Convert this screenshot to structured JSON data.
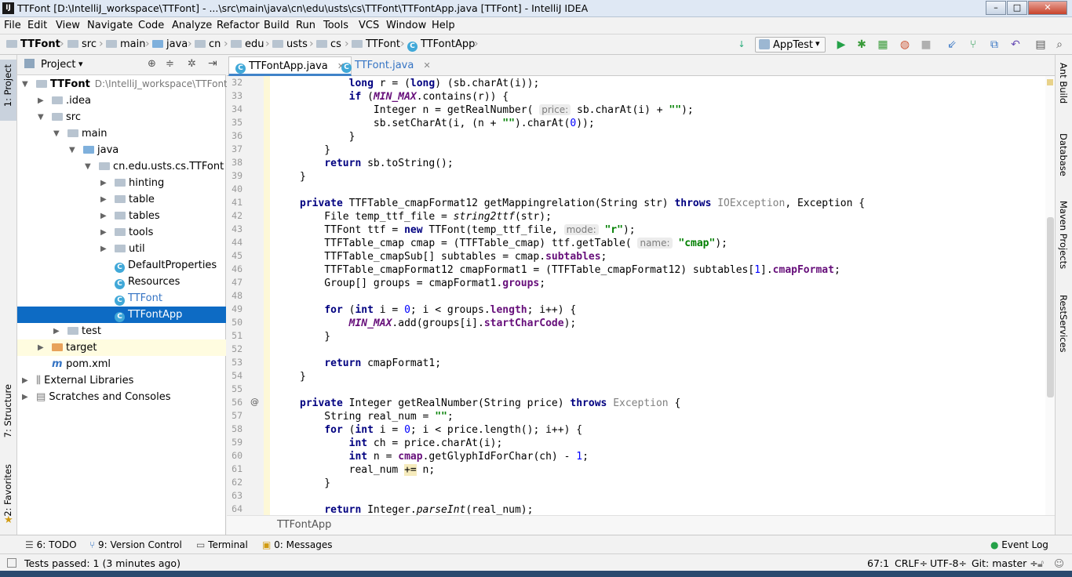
{
  "window": {
    "title": "TTFont [D:\\IntelliJ_workspace\\TTFont] - ...\\src\\main\\java\\cn\\edu\\usts\\cs\\TTFont\\TTFontApp.java [TTFont] - IntelliJ IDEA",
    "app_icon": "IJ",
    "minimize": "–",
    "maximize": "□",
    "close": "✕"
  },
  "menu": [
    "File",
    "Edit",
    "View",
    "Navigate",
    "Code",
    "Analyze",
    "Refactor",
    "Build",
    "Run",
    "Tools",
    "VCS",
    "Window",
    "Help"
  ],
  "breadcrumbs": [
    "TTFont",
    "src",
    "main",
    "java",
    "cn",
    "edu",
    "usts",
    "cs",
    "TTFont",
    "TTFontApp"
  ],
  "run_config": "AppTest",
  "colors": {
    "selection": "#0d6bc4",
    "keyword": "#000080",
    "string": "#008000",
    "number": "#0000ff",
    "field": "#660e7a"
  },
  "project_panel": {
    "title": "Project",
    "tree": [
      {
        "label": "TTFont",
        "extra": "D:\\IntelliJ_workspace\\TTFont",
        "indent": 0,
        "arrow": "open",
        "icon": "module-folder-icon"
      },
      {
        "label": ".idea",
        "indent": 1,
        "arrow": "closed",
        "icon": "folder-icon"
      },
      {
        "label": "src",
        "indent": 1,
        "arrow": "open",
        "icon": "folder-icon"
      },
      {
        "label": "main",
        "indent": 2,
        "arrow": "open",
        "icon": "folder-icon"
      },
      {
        "label": "java",
        "indent": 3,
        "arrow": "open",
        "icon": "source-folder-icon"
      },
      {
        "label": "cn.edu.usts.cs.TTFont",
        "indent": 4,
        "arrow": "open",
        "icon": "package-icon"
      },
      {
        "label": "hinting",
        "indent": 5,
        "arrow": "closed",
        "icon": "package-icon"
      },
      {
        "label": "table",
        "indent": 5,
        "arrow": "closed",
        "icon": "package-icon"
      },
      {
        "label": "tables",
        "indent": 5,
        "arrow": "closed",
        "icon": "package-icon"
      },
      {
        "label": "tools",
        "indent": 5,
        "arrow": "closed",
        "icon": "package-icon"
      },
      {
        "label": "util",
        "indent": 5,
        "arrow": "closed",
        "icon": "package-icon"
      },
      {
        "label": "DefaultProperties",
        "indent": 5,
        "arrow": "none",
        "icon": "class-icon"
      },
      {
        "label": "Resources",
        "indent": 5,
        "arrow": "none",
        "icon": "class-icon"
      },
      {
        "label": "TTFont",
        "indent": 5,
        "arrow": "none",
        "icon": "class-icon"
      },
      {
        "label": "TTFontApp",
        "indent": 5,
        "arrow": "none",
        "icon": "class-icon",
        "selected": true
      },
      {
        "label": "test",
        "indent": 2,
        "arrow": "closed",
        "icon": "folder-icon"
      },
      {
        "label": "target",
        "indent": 1,
        "arrow": "closed",
        "icon": "excluded-folder-icon",
        "highlight": true
      },
      {
        "label": "pom.xml",
        "indent": 1,
        "arrow": "none",
        "icon": "maven-icon"
      },
      {
        "label": "External Libraries",
        "indent": 0,
        "arrow": "closed",
        "icon": "library-icon"
      },
      {
        "label": "Scratches and Consoles",
        "indent": 0,
        "arrow": "closed",
        "icon": "scratch-icon"
      }
    ]
  },
  "editor": {
    "tabs": [
      {
        "label": "TTFontApp.java",
        "active": true
      },
      {
        "label": "TTFont.java",
        "active": false
      }
    ],
    "first_line": 32,
    "bottom_breadcrumb": "TTFontApp",
    "lines": [
      [
        [
          "",
          "        "
        ],
        [
          "kw",
          "long"
        ],
        [
          "",
          " r = ("
        ],
        [
          "kw",
          "long"
        ],
        [
          "",
          ") (sb.charAt(i));"
        ]
      ],
      [
        [
          "",
          "        "
        ],
        [
          "kw",
          "if"
        ],
        [
          "",
          " ("
        ],
        [
          "st",
          "MIN_MAX"
        ],
        [
          "",
          ".contains(r)) {"
        ]
      ],
      [
        [
          "",
          "            Integer n = getRealNumber( "
        ],
        [
          "hint",
          "price:"
        ],
        [
          "",
          " sb.charAt(i) + "
        ],
        [
          "str",
          "\"\""
        ],
        [
          "",
          ");"
        ]
      ],
      [
        [
          "",
          "            sb.setCharAt(i, (n + "
        ],
        [
          "str",
          "\"\""
        ],
        [
          "",
          ").charAt("
        ],
        [
          "num",
          "0"
        ],
        [
          "",
          "));"
        ]
      ],
      [
        [
          "",
          "        }"
        ]
      ],
      [
        [
          "",
          "    }"
        ]
      ],
      [
        [
          "",
          "    "
        ],
        [
          "kw",
          "return"
        ],
        [
          "",
          " sb.toString();"
        ]
      ],
      [
        [
          "",
          "}"
        ]
      ],
      [
        [
          "",
          ""
        ]
      ],
      [
        [
          "kw",
          "private"
        ],
        [
          "",
          " TTFTable_cmapFormat12 getMappingrelation(String str) "
        ],
        [
          "kw",
          "throws"
        ],
        [
          "",
          " "
        ],
        [
          "gray",
          "IOException"
        ],
        [
          "",
          ", Exception {"
        ]
      ],
      [
        [
          "",
          "    File temp_ttf_file = "
        ],
        [
          "it",
          "string2ttf"
        ],
        [
          "",
          "(str);"
        ]
      ],
      [
        [
          "",
          "    TTFont ttf = "
        ],
        [
          "kw",
          "new"
        ],
        [
          "",
          " TTFont(temp_ttf_file, "
        ],
        [
          "hint",
          "mode:"
        ],
        [
          "",
          " "
        ],
        [
          "str",
          "\"r\""
        ],
        [
          "",
          ");"
        ]
      ],
      [
        [
          "",
          "    TTFTable_cmap cmap = (TTFTable_cmap) ttf.getTable( "
        ],
        [
          "hint",
          "name:"
        ],
        [
          "",
          " "
        ],
        [
          "str",
          "\"cmap\""
        ],
        [
          "",
          ");"
        ]
      ],
      [
        [
          "",
          "    TTFTable_cmapSub[] subtables = cmap."
        ],
        [
          "fld",
          "subtables"
        ],
        [
          "",
          ";"
        ]
      ],
      [
        [
          "",
          "    TTFTable_cmapFormat12 cmapFormat1 = (TTFTable_cmapFormat12) subtables["
        ],
        [
          "num",
          "1"
        ],
        [
          "",
          "]."
        ],
        [
          "fld",
          "cmapFormat"
        ],
        [
          "",
          ";"
        ]
      ],
      [
        [
          "",
          "    Group[] groups = cmapFormat1."
        ],
        [
          "fld",
          "groups"
        ],
        [
          "",
          ";"
        ]
      ],
      [
        [
          "",
          ""
        ]
      ],
      [
        [
          "",
          "    "
        ],
        [
          "kw",
          "for"
        ],
        [
          "",
          " ("
        ],
        [
          "kw",
          "int"
        ],
        [
          "",
          " i = "
        ],
        [
          "num",
          "0"
        ],
        [
          "",
          "; i < groups."
        ],
        [
          "fld",
          "length"
        ],
        [
          "",
          "; i++) {"
        ]
      ],
      [
        [
          "",
          "        "
        ],
        [
          "st",
          "MIN_MAX"
        ],
        [
          "",
          ".add(groups[i]."
        ],
        [
          "fld",
          "startCharCode"
        ],
        [
          "",
          ");"
        ]
      ],
      [
        [
          "",
          "    }"
        ]
      ],
      [
        [
          "",
          ""
        ]
      ],
      [
        [
          "",
          "    "
        ],
        [
          "kw",
          "return"
        ],
        [
          "",
          " cmapFormat1;"
        ]
      ],
      [
        [
          "",
          "}"
        ]
      ],
      [
        [
          "",
          ""
        ]
      ],
      [
        [
          "kw",
          "private"
        ],
        [
          "",
          " Integer getRealNumber(String price) "
        ],
        [
          "kw",
          "throws"
        ],
        [
          "",
          " "
        ],
        [
          "gray",
          "Exception"
        ],
        [
          "",
          " {"
        ]
      ],
      [
        [
          "",
          "    String real_num = "
        ],
        [
          "str",
          "\"\""
        ],
        [
          "",
          ";"
        ]
      ],
      [
        [
          "",
          "    "
        ],
        [
          "kw",
          "for"
        ],
        [
          "",
          " ("
        ],
        [
          "kw",
          "int"
        ],
        [
          "",
          " i = "
        ],
        [
          "num",
          "0"
        ],
        [
          "",
          "; i < price.length(); i++) {"
        ]
      ],
      [
        [
          "",
          "        "
        ],
        [
          "kw",
          "int"
        ],
        [
          "",
          " ch = price.charAt(i);"
        ]
      ],
      [
        [
          "",
          "        "
        ],
        [
          "kw",
          "int"
        ],
        [
          "",
          " n = "
        ],
        [
          "fld",
          "cmap"
        ],
        [
          "",
          ".getGlyphIdForChar(ch) - "
        ],
        [
          "num",
          "1"
        ],
        [
          "",
          ";"
        ]
      ],
      [
        [
          "",
          "        real_num "
        ],
        [
          "hlbg",
          "+="
        ],
        [
          "",
          " n;"
        ]
      ],
      [
        [
          "",
          "    }"
        ]
      ],
      [
        [
          "",
          ""
        ]
      ],
      [
        [
          "",
          "    "
        ],
        [
          "kw",
          "return"
        ],
        [
          "",
          " Integer."
        ],
        [
          "it",
          "parseInt"
        ],
        [
          "",
          "(real_num);"
        ]
      ]
    ]
  },
  "left_tools": [
    "1: Project",
    "7: Structure",
    "2: Favorites"
  ],
  "right_tools": [
    "Ant Build",
    "Database",
    "Maven Projects",
    "RestServices"
  ],
  "bottom_tools": [
    "6: TODO",
    "9: Version Control",
    "Terminal",
    "0: Messages",
    "Event Log"
  ],
  "status": {
    "message": "Tests passed: 1 (3 minutes ago)",
    "position": "67:1",
    "line_sep": "CRLF÷",
    "encoding": "UTF-8÷",
    "git": "Git: master ÷"
  }
}
